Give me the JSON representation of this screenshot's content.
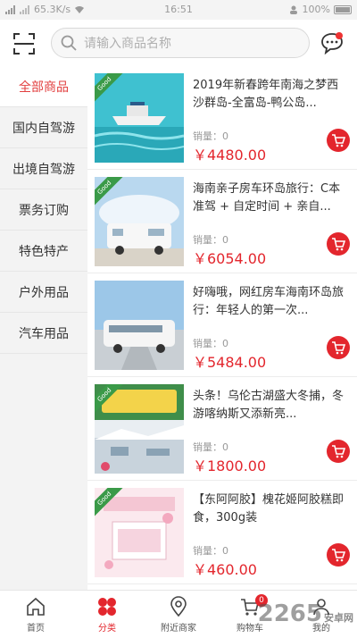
{
  "status_bar": {
    "network": "65.3K/s",
    "time": "16:51",
    "battery": "100%"
  },
  "search": {
    "placeholder": "请输入商品名称"
  },
  "sidebar": {
    "items": [
      {
        "label": "全部商品",
        "active": true
      },
      {
        "label": "国内自驾游",
        "active": false
      },
      {
        "label": "出境自驾游",
        "active": false
      },
      {
        "label": "票务订购",
        "active": false
      },
      {
        "label": "特色特产",
        "active": false
      },
      {
        "label": "户外用品",
        "active": false
      },
      {
        "label": "汽车用品",
        "active": false
      }
    ]
  },
  "products": [
    {
      "title": "2019年新春跨年南海之梦西沙群岛-全富岛-鸭公岛...",
      "sold": "销量：0",
      "price": "￥4480.00",
      "image": "boat-sea"
    },
    {
      "title": "海南亲子房车环岛旅行：C本准驾 + 自定时间 + 亲自...",
      "sold": "销量：0",
      "price": "￥6054.00",
      "image": "rv-sky"
    },
    {
      "title": "好嗨哦，网红房车海南环岛旅行：年轻人的第一次...",
      "sold": "销量：0",
      "price": "￥5484.00",
      "image": "rv-road"
    },
    {
      "title": "头条！乌伦古湖盛大冬捕，冬游喀纳斯又添新亮...",
      "sold": "销量：0",
      "price": "￥1800.00",
      "image": "winter-lake"
    },
    {
      "title": "【东阿阿胶】槐花姬阿胶糕即食，300g装",
      "sold": "销量：0",
      "price": "￥460.00",
      "image": "gift-box"
    }
  ],
  "tabbar": {
    "items": [
      {
        "label": "首页",
        "icon": "home-icon"
      },
      {
        "label": "分类",
        "icon": "category-icon",
        "active": true
      },
      {
        "label": "附近商家",
        "icon": "location-icon"
      },
      {
        "label": "购物车",
        "icon": "cart-icon",
        "badge": "0"
      },
      {
        "label": "我的",
        "icon": "user-icon"
      }
    ]
  },
  "watermark": {
    "text": "2265",
    "sub": "安卓网"
  },
  "colors": {
    "accent": "#e3262d",
    "sidebar_bg": "#f3f3f3"
  }
}
